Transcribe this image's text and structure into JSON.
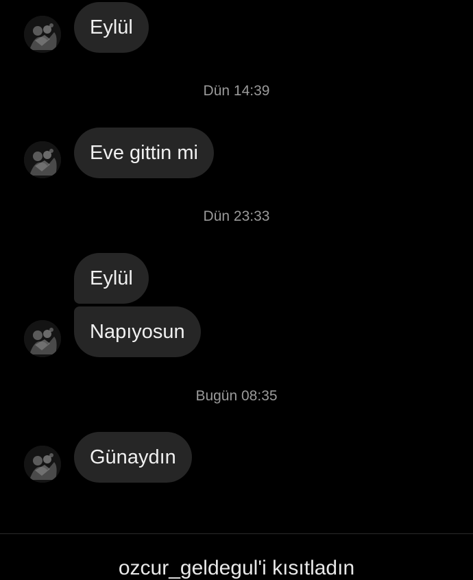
{
  "avatar_icon": "contact-avatar-photo",
  "messages": [
    {
      "text": "Eylül"
    },
    {
      "text": "Eve gittin mi"
    },
    {
      "text": "Eylül"
    },
    {
      "text": "Napıyosun"
    },
    {
      "text": "Günaydın"
    }
  ],
  "timestamps": [
    "Dün 14:39",
    "Dün 23:33",
    "Bugün 08:35"
  ],
  "footer": {
    "restricted_text": "ozcur_geldegul'i kısıtladın"
  }
}
